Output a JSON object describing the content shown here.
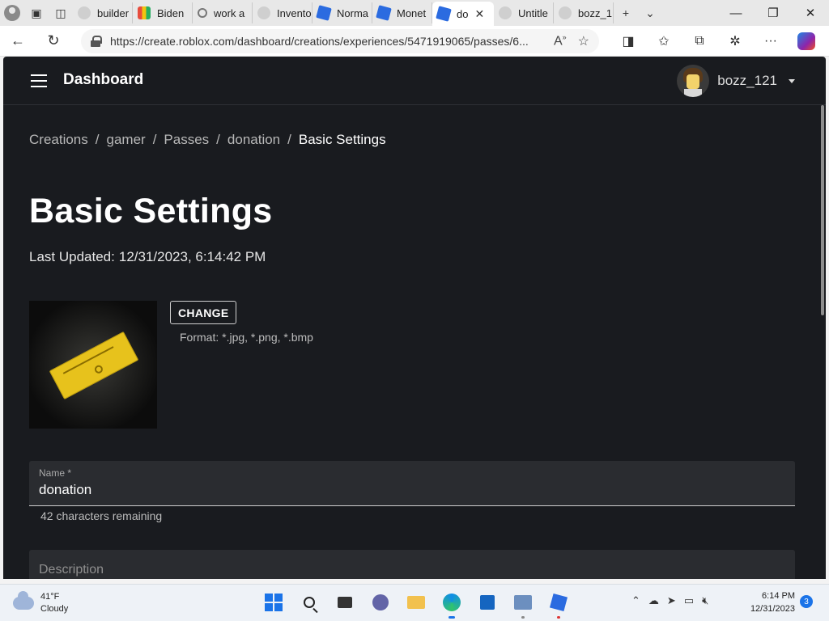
{
  "browser": {
    "tabs": [
      {
        "label": "builder",
        "icon": "gray"
      },
      {
        "label": "Biden",
        "icon": "multi"
      },
      {
        "label": "work a",
        "icon": "search"
      },
      {
        "label": "Invento",
        "icon": "gray"
      },
      {
        "label": "Norma",
        "icon": "roblox"
      },
      {
        "label": "Monet",
        "icon": "roblox"
      },
      {
        "label": "do",
        "icon": "roblox",
        "active": true
      },
      {
        "label": "Untitle",
        "icon": "gray"
      },
      {
        "label": "bozz_1",
        "icon": "gray"
      }
    ],
    "new_tab": "+",
    "tab_list": "⌄",
    "window": {
      "minimize": "—",
      "maximize": "❐",
      "close": "✕"
    },
    "url": "https://create.roblox.com/dashboard/creations/experiences/5471919065/passes/6..."
  },
  "topnav": {
    "title": "Dashboard",
    "username": "bozz_121"
  },
  "breadcrumb": [
    "Creations",
    "gamer",
    "Passes",
    "donation",
    "Basic Settings"
  ],
  "breadcrumb_sep": "/",
  "page": {
    "title": "Basic Settings",
    "last_updated_label": "Last Updated:",
    "last_updated_value": "12/31/2023, 6:14:42 PM",
    "change_button": "CHANGE",
    "format_hint": "Format: *.jpg, *.png, *.bmp",
    "name_label": "Name *",
    "name_value": "donation",
    "name_helper": "42 characters remaining",
    "description_label": "Description"
  },
  "taskbar": {
    "temperature": "41°F",
    "condition": "Cloudy",
    "time": "6:14 PM",
    "date": "12/31/2023",
    "notification_count": "3"
  },
  "colors": {
    "page_bg": "#191b1f",
    "field_bg": "#2a2c30",
    "ticket": "#e7c21c",
    "accent": "#1a73e8"
  }
}
